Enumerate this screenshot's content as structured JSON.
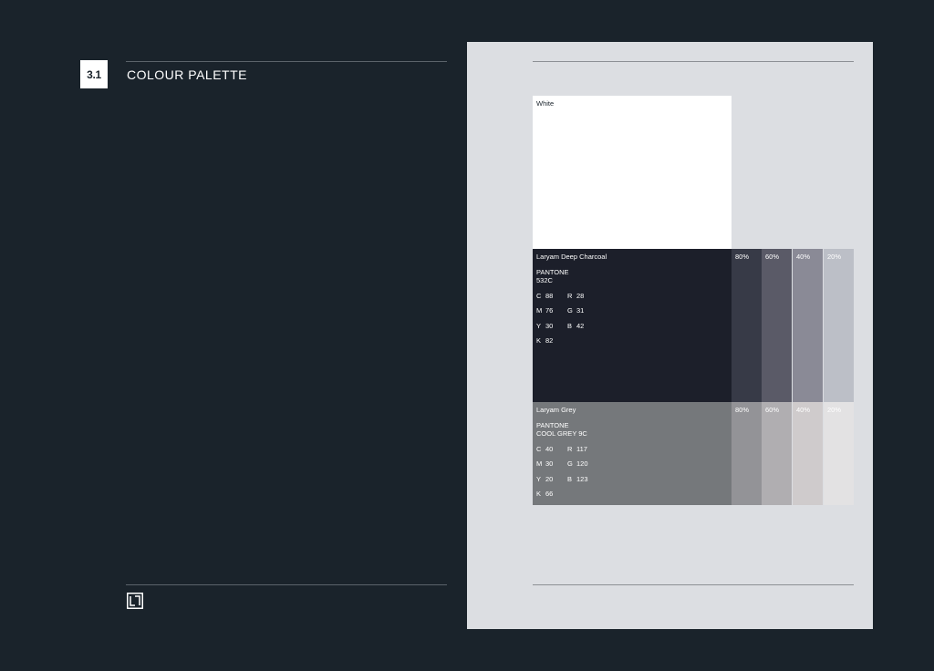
{
  "header": {
    "section_number": "3.1",
    "section_title": "COLOUR PALETTE"
  },
  "icons": {
    "logo": "brand-mark-icon"
  },
  "swatches": {
    "white": {
      "label": "White",
      "color": "#ffffff"
    },
    "charcoal": {
      "name": "Laryam Deep Charcoal",
      "pantone_line1": "PANTONE",
      "pantone_line2": "532C",
      "color": "#1c1f2a",
      "cmyk": [
        {
          "label": "C",
          "value": "88"
        },
        {
          "label": "M",
          "value": "76"
        },
        {
          "label": "Y",
          "value": "30"
        },
        {
          "label": "K",
          "value": "82"
        }
      ],
      "rgb": [
        {
          "label": "R",
          "value": "28"
        },
        {
          "label": "G",
          "value": "31"
        },
        {
          "label": "B",
          "value": "42"
        }
      ],
      "tints": [
        {
          "label": "80%",
          "color": "#373a47"
        },
        {
          "label": "60%",
          "color": "#5a5a67"
        },
        {
          "label": "40%",
          "color": "#8a8a96"
        },
        {
          "label": "20%",
          "color": "#bcbfc7"
        }
      ]
    },
    "grey": {
      "name": "Laryam Grey",
      "pantone_line1": "PANTONE",
      "pantone_line2": "COOL GREY 9C",
      "color": "#75787b",
      "cmyk": [
        {
          "label": "C",
          "value": "40"
        },
        {
          "label": "M",
          "value": "30"
        },
        {
          "label": "Y",
          "value": "20"
        },
        {
          "label": "K",
          "value": "66"
        }
      ],
      "rgb": [
        {
          "label": "R",
          "value": "117"
        },
        {
          "label": "G",
          "value": "120"
        },
        {
          "label": "B",
          "value": "123"
        }
      ],
      "tints": [
        {
          "label": "80%",
          "color": "#939397"
        },
        {
          "label": "60%",
          "color": "#b0aeb1"
        },
        {
          "label": "40%",
          "color": "#cfcbcc"
        },
        {
          "label": "20%",
          "color": "#e3e2e3"
        }
      ]
    }
  }
}
